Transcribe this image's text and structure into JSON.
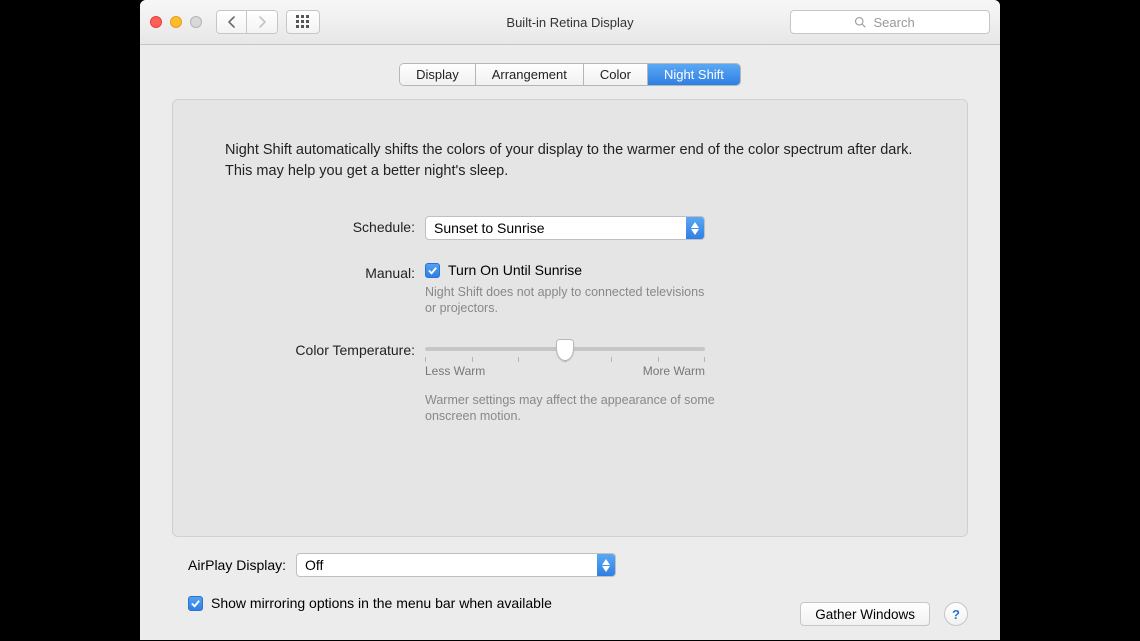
{
  "window": {
    "title": "Built-in Retina Display"
  },
  "search": {
    "placeholder": "Search"
  },
  "tabs": {
    "0": "Display",
    "1": "Arrangement",
    "2": "Color",
    "3": "Night Shift"
  },
  "nightshift": {
    "intro": "Night Shift automatically shifts the colors of your display to the warmer end of the color spectrum after dark. This may help you get a better night's sleep.",
    "schedule_label": "Schedule:",
    "schedule_value": "Sunset to Sunrise",
    "manual_label": "Manual:",
    "manual_checkbox_label": "Turn On Until Sunrise",
    "manual_checked": true,
    "manual_help": "Night Shift does not apply to connected televisions or projectors.",
    "temp_label": "Color Temperature:",
    "temp_less": "Less Warm",
    "temp_more": "More Warm",
    "temp_help": "Warmer settings may affect the appearance of some onscreen motion."
  },
  "airplay": {
    "label": "AirPlay Display:",
    "value": "Off"
  },
  "mirroring": {
    "checked": true,
    "label": "Show mirroring options in the menu bar when available"
  },
  "buttons": {
    "gather": "Gather Windows",
    "help": "?"
  }
}
